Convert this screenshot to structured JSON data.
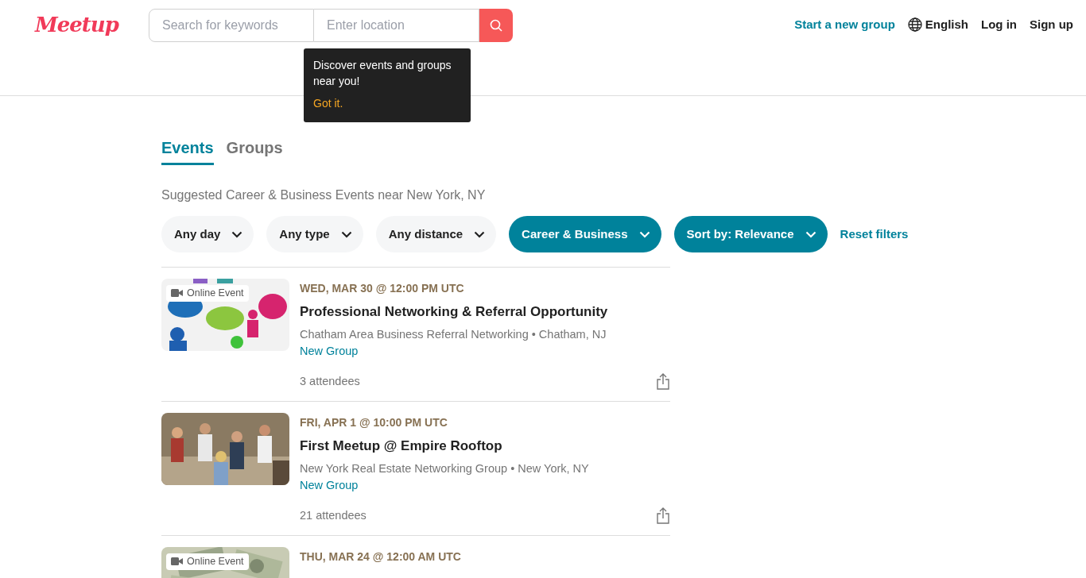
{
  "header": {
    "logo": "Meetup",
    "search": {
      "keyword_placeholder": "Search for keywords",
      "location_placeholder": "Enter location"
    },
    "nav": [
      {
        "label": "Start a new group",
        "kind": "accent"
      },
      {
        "label": "English",
        "kind": "language"
      },
      {
        "label": "Log in",
        "kind": "plain"
      },
      {
        "label": "Sign up",
        "kind": "plain"
      }
    ]
  },
  "tooltip": {
    "text": "Discover events and groups near you!",
    "action": "Got it."
  },
  "tabs": [
    {
      "label": "Events",
      "selected": true
    },
    {
      "label": "Groups",
      "selected": false
    }
  ],
  "subtitle": "Suggested Career & Business Events near New York, NY",
  "filters": [
    {
      "label": "Any day",
      "selected": false
    },
    {
      "label": "Any type",
      "selected": false
    },
    {
      "label": "Any distance",
      "selected": false
    },
    {
      "label": "Career & Business",
      "selected": true
    },
    {
      "label": "Sort by: Relevance",
      "selected": true
    }
  ],
  "reset": "Reset filters",
  "events": [
    {
      "date": "WED, MAR 30 @ 12:00 PM UTC",
      "title": "Professional Networking & Referral Opportunity",
      "group": "Chatham Area Business Referral Networking • Chatham, NJ",
      "tag": "New Group",
      "attendees": "3 attendees",
      "online_badge": "Online Event"
    },
    {
      "date": "FRI, APR 1 @ 10:00 PM UTC",
      "title": "First Meetup @ Empire Rooftop",
      "group": "New York Real Estate Networking Group • New York, NY",
      "tag": "New Group",
      "attendees": "21 attendees"
    },
    {
      "date": "THU, MAR 24 @ 12:00 AM UTC",
      "online_badge": "Online Event"
    }
  ]
}
